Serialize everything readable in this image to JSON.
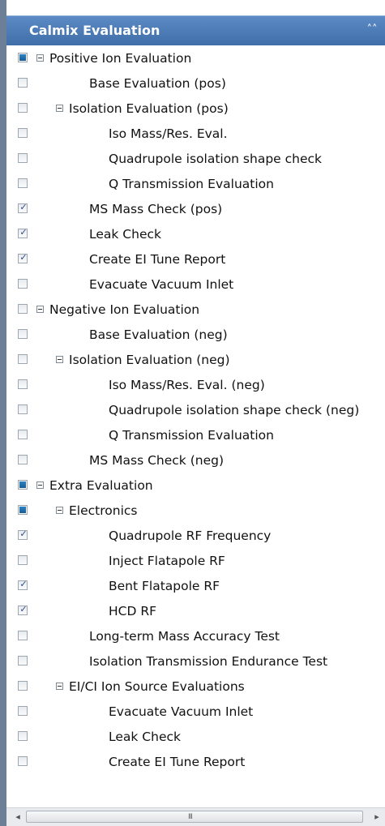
{
  "panel": {
    "title": "Calmix Evaluation",
    "collapse_icon": "double-chevron-up-icon",
    "collapse_glyph": "˄˄"
  },
  "tree": [
    {
      "label": "Positive Ion Evaluation",
      "level": 0,
      "expandable": true,
      "state": "partial"
    },
    {
      "label": "Base Evaluation (pos)",
      "level": 1,
      "expandable": false,
      "state": "unchecked"
    },
    {
      "label": "Isolation Evaluation (pos)",
      "level": 1,
      "expandable": true,
      "state": "unchecked"
    },
    {
      "label": "Iso Mass/Res. Eval.",
      "level": 2,
      "expandable": false,
      "state": "unchecked"
    },
    {
      "label": "Quadrupole isolation shape check",
      "level": 2,
      "expandable": false,
      "state": "unchecked"
    },
    {
      "label": "Q Transmission Evaluation",
      "level": 2,
      "expandable": false,
      "state": "unchecked"
    },
    {
      "label": "MS Mass Check (pos)",
      "level": 1,
      "expandable": false,
      "state": "checked"
    },
    {
      "label": "Leak Check",
      "level": 1,
      "expandable": false,
      "state": "checked"
    },
    {
      "label": "Create EI Tune Report",
      "level": 1,
      "expandable": false,
      "state": "checked"
    },
    {
      "label": "Evacuate Vacuum Inlet",
      "level": 1,
      "expandable": false,
      "state": "unchecked"
    },
    {
      "label": "Negative Ion Evaluation",
      "level": 0,
      "expandable": true,
      "state": "unchecked"
    },
    {
      "label": "Base Evaluation (neg)",
      "level": 1,
      "expandable": false,
      "state": "unchecked"
    },
    {
      "label": "Isolation Evaluation (neg)",
      "level": 1,
      "expandable": true,
      "state": "unchecked"
    },
    {
      "label": "Iso Mass/Res. Eval. (neg)",
      "level": 2,
      "expandable": false,
      "state": "unchecked"
    },
    {
      "label": "Quadrupole isolation shape check (neg)",
      "level": 2,
      "expandable": false,
      "state": "unchecked"
    },
    {
      "label": "Q Transmission Evaluation",
      "level": 2,
      "expandable": false,
      "state": "unchecked"
    },
    {
      "label": "MS Mass Check (neg)",
      "level": 1,
      "expandable": false,
      "state": "unchecked"
    },
    {
      "label": "Extra Evaluation",
      "level": 0,
      "expandable": true,
      "state": "partial"
    },
    {
      "label": "Electronics",
      "level": 1,
      "expandable": true,
      "state": "partial"
    },
    {
      "label": "Quadrupole RF Frequency",
      "level": 2,
      "expandable": false,
      "state": "checked"
    },
    {
      "label": "Inject Flatapole RF",
      "level": 2,
      "expandable": false,
      "state": "unchecked"
    },
    {
      "label": "Bent Flatapole RF",
      "level": 2,
      "expandable": false,
      "state": "checked"
    },
    {
      "label": "HCD RF",
      "level": 2,
      "expandable": false,
      "state": "checked"
    },
    {
      "label": "Long-term Mass Accuracy Test",
      "level": 1,
      "expandable": false,
      "state": "unchecked"
    },
    {
      "label": "Isolation Transmission Endurance Test",
      "level": 1,
      "expandable": false,
      "state": "unchecked"
    },
    {
      "label": "EI/CI Ion Source Evaluations",
      "level": 1,
      "expandable": true,
      "state": "unchecked"
    },
    {
      "label": "Evacuate Vacuum Inlet",
      "level": 2,
      "expandable": false,
      "state": "unchecked"
    },
    {
      "label": "Leak Check",
      "level": 2,
      "expandable": false,
      "state": "unchecked"
    },
    {
      "label": "Create EI Tune Report",
      "level": 2,
      "expandable": false,
      "state": "unchecked"
    }
  ],
  "scrollbar": {
    "left_arrow": "◂",
    "right_arrow": "▸",
    "grip": "III"
  },
  "colors": {
    "header": "#4a7cb8",
    "partial_fill": "#2e83c4",
    "check_mark": "#2e4b8a"
  }
}
